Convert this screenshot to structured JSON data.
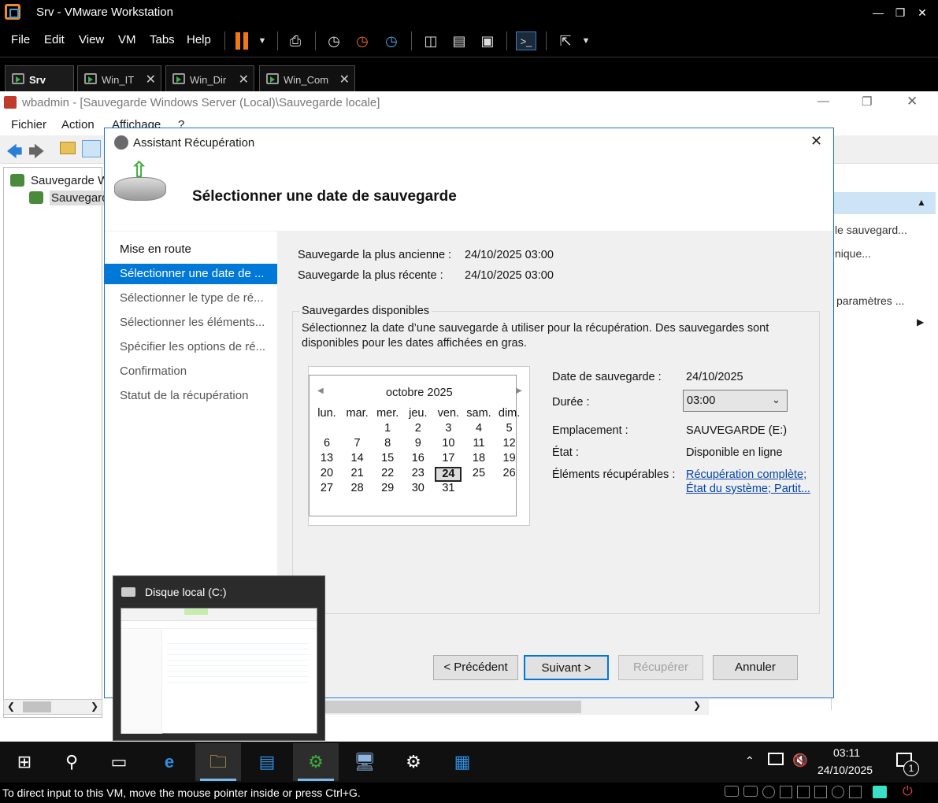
{
  "vmware": {
    "title": "Srv - VMware Workstation",
    "menu": [
      "File",
      "Edit",
      "View",
      "VM",
      "Tabs",
      "Help"
    ],
    "tabs": [
      {
        "label": "Srv",
        "active": true
      },
      {
        "label": "Win_IT",
        "active": false
      },
      {
        "label": "Win_Dir",
        "active": false
      },
      {
        "label": "Win_Com",
        "active": false
      }
    ],
    "status_text": "To direct input to this VM, move the mouse pointer inside or press Ctrl+G."
  },
  "wbadmin": {
    "title": "wbadmin - [Sauvegarde Windows Server (Local)\\Sauvegarde locale]",
    "menu": [
      "Fichier",
      "Action",
      "Affichage",
      "?"
    ],
    "tree": [
      "Sauvegarde W",
      "Sauvegard"
    ],
    "actions": [
      "le sauvegard...",
      "nique...",
      "paramètres ..."
    ]
  },
  "wizard": {
    "title": "Assistant Récupération",
    "heading": "Sélectionner une date de sauvegarde",
    "nav": [
      "Mise en route",
      "Sélectionner une date de ...",
      "Sélectionner le type de ré...",
      "Sélectionner les éléments...",
      "Spécifier les options de ré...",
      "Confirmation",
      "Statut de la récupération"
    ],
    "oldest_label": "Sauvegarde la plus ancienne :",
    "oldest_value": "24/10/2025 03:00",
    "newest_label": "Sauvegarde la plus récente :",
    "newest_value": "24/10/2025 03:00",
    "group_title": "Sauvegardes disponibles",
    "group_desc": "Sélectionnez la date d’une sauvegarde à utiliser pour la récupération. Des sauvegardes sont disponibles pour les dates affichées en gras.",
    "calendar": {
      "month": "octobre 2025",
      "weekdays": [
        "lun.",
        "mar.",
        "mer.",
        "jeu.",
        "ven.",
        "sam.",
        "dim."
      ],
      "selected_day": 24,
      "bold_days": [
        24
      ]
    },
    "details": {
      "date_label": "Date de sauvegarde :",
      "date_value": "24/10/2025",
      "time_label": "Durée :",
      "time_value": "03:00",
      "location_label": "Emplacement :",
      "location_value": "SAUVEGARDE (E:)",
      "state_label": "État :",
      "state_value": "Disponible en ligne",
      "items_label": "Éléments récupérables :",
      "items": [
        "Récupération complète;",
        "État du système; Partit..."
      ]
    },
    "buttons": {
      "prev": "< Précédent",
      "next": "Suivant >",
      "recover": "Récupérer",
      "cancel": "Annuler"
    }
  },
  "thumbnail": {
    "title": "Disque local (C:)"
  },
  "taskbar": {
    "time": "03:11",
    "date": "24/10/2025",
    "notif_count": "1"
  }
}
